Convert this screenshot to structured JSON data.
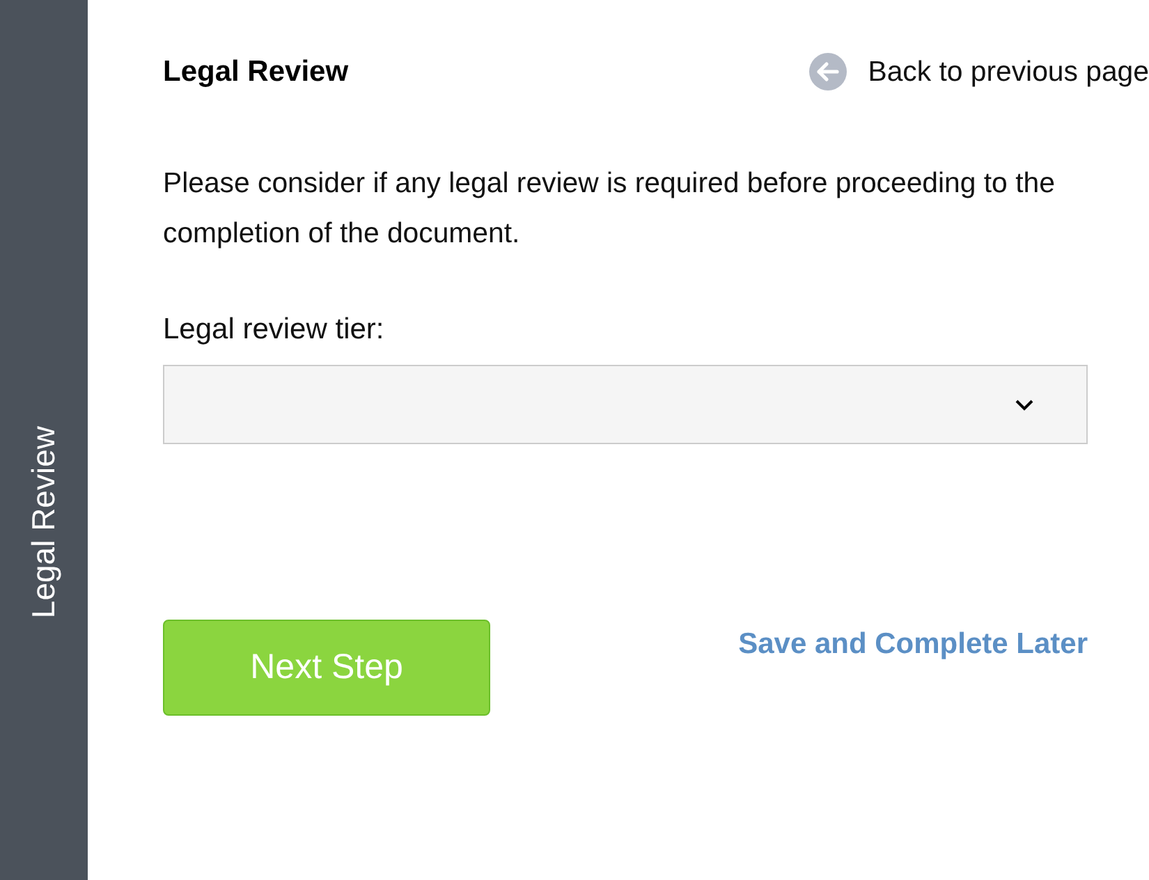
{
  "sidebar": {
    "label": "Legal Review"
  },
  "header": {
    "title": "Legal Review",
    "back_link": "Back to previous page"
  },
  "intro": "Please consider if any legal review is required before proceeding to the completion of the document.",
  "tier_field": {
    "label": "Legal review tier:"
  },
  "actions": {
    "primary": "Next Step",
    "secondary": "Save and Complete Later"
  }
}
